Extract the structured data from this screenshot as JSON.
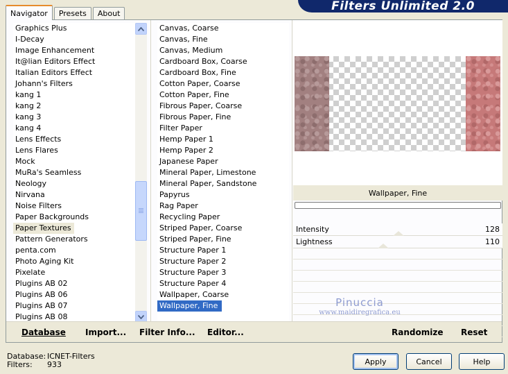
{
  "title": "Filters Unlimited 2.0",
  "tabs": [
    {
      "label": "Navigator",
      "active": true
    },
    {
      "label": "Presets",
      "active": false
    },
    {
      "label": "About",
      "active": false
    }
  ],
  "categories": [
    "Graphics Plus",
    "I-Decay",
    "Image Enhancement",
    "It@lian Editors Effect",
    "Italian Editors Effect",
    "Johann's Filters",
    "kang 1",
    "kang 2",
    "kang 3",
    "kang 4",
    "Lens Effects",
    "Lens Flares",
    "Mock",
    "MuRa's Seamless",
    "Neology",
    "Nirvana",
    "Noise Filters",
    "Paper Backgrounds",
    "Paper Textures",
    "Pattern Generators",
    "penta.com",
    "Photo Aging Kit",
    "Pixelate",
    "Plugins AB 02",
    "Plugins AB 06",
    "Plugins AB 07",
    "Plugins AB 08"
  ],
  "selected_category": "Paper Textures",
  "filters": [
    "Canvas, Coarse",
    "Canvas, Fine",
    "Canvas, Medium",
    "Cardboard Box, Coarse",
    "Cardboard Box, Fine",
    "Cotton Paper, Coarse",
    "Cotton Paper, Fine",
    "Fibrous Paper, Coarse",
    "Fibrous Paper, Fine",
    "Filter Paper",
    "Hemp Paper 1",
    "Hemp Paper 2",
    "Japanese Paper",
    "Mineral Paper, Limestone",
    "Mineral Paper, Sandstone",
    "Papyrus",
    "Rag Paper",
    "Recycling Paper",
    "Striped Paper, Coarse",
    "Striped Paper, Fine",
    "Structure Paper 1",
    "Structure Paper 2",
    "Structure Paper 3",
    "Structure Paper 4",
    "Wallpaper, Coarse",
    "Wallpaper, Fine"
  ],
  "selected_filter": "Wallpaper, Fine",
  "preview_filter_name": "Wallpaper, Fine",
  "params": [
    {
      "label": "Intensity",
      "value": "128",
      "fraction": 0.502
    },
    {
      "label": "Lightness",
      "value": "110",
      "fraction": 0.431
    }
  ],
  "watermark": {
    "line1": "Pinuccia",
    "line2": "www.maidiregrafica.eu"
  },
  "bottom_buttons": {
    "database": "Database",
    "import": "Import...",
    "filter_info": "Filter Info...",
    "editor": "Editor...",
    "randomize": "Randomize",
    "reset": "Reset"
  },
  "info": {
    "database_label": "Database:",
    "database_value": "ICNET-Filters",
    "filters_label": "Filters:",
    "filters_value": "933"
  },
  "dialog_buttons": {
    "apply": "Apply",
    "cancel": "Cancel",
    "help": "Help"
  }
}
